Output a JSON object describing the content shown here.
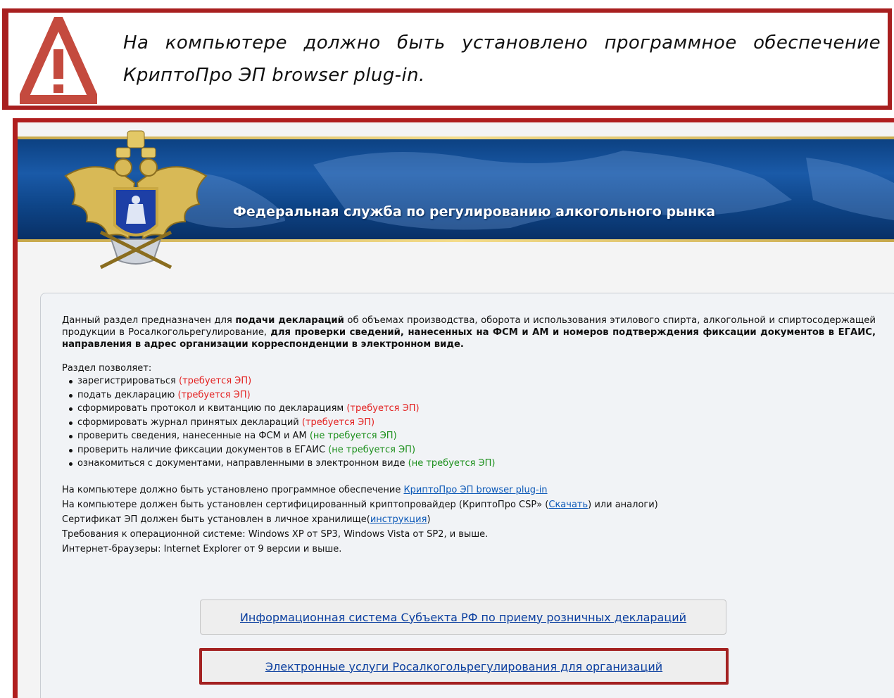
{
  "warning": {
    "text": "На компьютере должно быть установлено программное обеспечение КриптоПро ЭП browser plug-in."
  },
  "header": {
    "title": "Федеральная служба по регулированию алкогольного рынка"
  },
  "intro": {
    "t1": "Данный раздел предназначен для ",
    "b1": "подачи деклараций",
    "t2": " об объемах производства, оборота и использования этилового спирта, алкогольной и спиртосодержащей продукции в Росалкогольрегулирование, ",
    "b2": "для проверки сведений, нанесенных на ФСМ и АМ и номеров подтверждения фиксации документов в ЕГАИС, направления в адрес организации корреспонденции в электронном виде."
  },
  "features": {
    "title": "Раздел позволяет:",
    "items": [
      {
        "text": "зарегистрироваться ",
        "status": "(требуется ЭП)"
      },
      {
        "text": "подать декларацию ",
        "status": "(требуется ЭП)"
      },
      {
        "text": "сформировать протокол и квитанцию по декларациям ",
        "status": "(требуется ЭП)"
      },
      {
        "text": "сформировать журнал принятых деклараций ",
        "status": "(требуется ЭП)"
      },
      {
        "text": "проверить сведения, нанесенные на ФСМ и АМ ",
        "status": "(не требуется ЭП)"
      },
      {
        "text": "проверить наличие фиксации документов в ЕГАИС ",
        "status": "(не требуется ЭП)"
      },
      {
        "text": "ознакомиться с документами, направленными в электронном виде ",
        "status": "(не требуется ЭП)"
      }
    ]
  },
  "requirements": {
    "line1_text": "На компьютере должно быть установлено программное обеспечение ",
    "line1_link": "КриптоПро ЭП browser plug-in",
    "line2_text": "На компьютере должен быть установлен сертифицированный криптопровайдер (КриптоПро CSP» (",
    "line2_link": "Скачать",
    "line2_tail": ") или аналоги)",
    "line3_text": "Сертификат ЭП должен быть установлен в личное хранилище(",
    "line3_link": "инструкция",
    "line3_tail": ")",
    "line4": "Требования к операционной системе: Windows XP от SP3, Windows Vista от SP2, и выше.",
    "line5": "Интернет-браузеры: Internet Explorer от 9 версии и выше."
  },
  "buttons": {
    "subject": "Информационная система Субъекта РФ по приему розничных деклараций",
    "organizations": "Электронные услуги Росалкогольрегулирования для организаций"
  },
  "colors": {
    "accent_red": "#a81f1f",
    "required": "#e32020",
    "not_required": "#1b8f1b",
    "link": "#0b58b7",
    "banner_blue": "#0e4588"
  },
  "icons": {
    "warning": "warning-triangle-icon",
    "emblem": "coat-of-arms-emblem"
  }
}
